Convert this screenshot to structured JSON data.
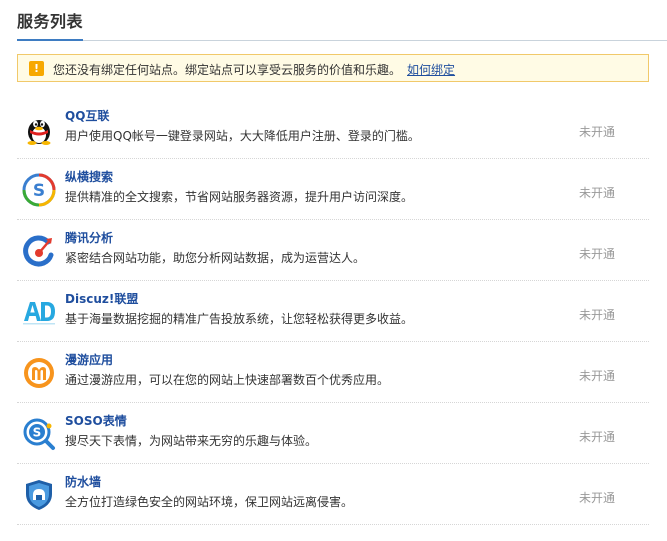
{
  "page": {
    "title": "服务列表"
  },
  "notice": {
    "icon": "info-icon",
    "icon_glyph": "!",
    "text": "您还没有绑定任何站点。绑定站点可以享受云服务的价值和乐趣。",
    "link": "如何绑定"
  },
  "services": [
    {
      "name": "QQ互联",
      "desc": "用户使用QQ帐号一键登录网站，大大降低用户注册、登录的门槛。",
      "status": "未开通",
      "icon": "qq-penguin-icon"
    },
    {
      "name": "纵横搜索",
      "desc": "提供精准的全文搜索，节省网站服务器资源，提升用户访问深度。",
      "status": "未开通",
      "icon": "soso-search-icon"
    },
    {
      "name": "腾讯分析",
      "desc": "紧密结合网站功能，助您分析网站数据，成为运营达人。",
      "status": "未开通",
      "icon": "analytics-icon"
    },
    {
      "name": "Discuz!联盟",
      "desc": "基于海量数据挖掘的精准广告投放系统，让您轻松获得更多收益。",
      "status": "未开通",
      "icon": "ad-icon"
    },
    {
      "name": "漫游应用",
      "desc": "通过漫游应用，可以在您的网站上快速部署数百个优秀应用。",
      "status": "未开通",
      "icon": "manyou-icon"
    },
    {
      "name": "SOSO表情",
      "desc": "搜尽天下表情，为网站带来无穷的乐趣与体验。",
      "status": "未开通",
      "icon": "soso-emoticon-icon"
    },
    {
      "name": "防水墙",
      "desc": "全方位打造绿色安全的网站环境，保卫网站远离侵害。",
      "status": "未开通",
      "icon": "firewall-shield-icon"
    }
  ]
}
